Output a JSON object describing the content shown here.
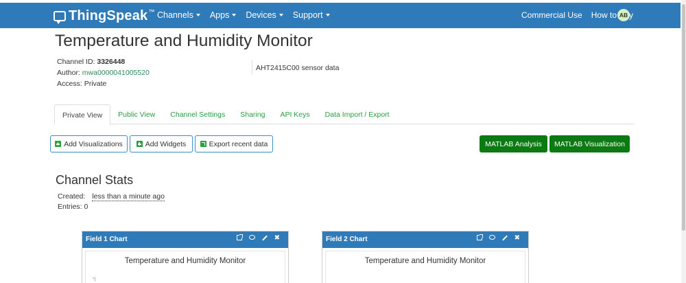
{
  "nav": {
    "brand": "ThingSpeak",
    "brand_mark": "™",
    "menu": [
      "Channels",
      "Apps",
      "Devices",
      "Support"
    ],
    "right_links": [
      "Commercial Use",
      "How to Buy"
    ],
    "avatar_initials": "AB"
  },
  "channel": {
    "title": "Temperature and Humidity Monitor",
    "id_label": "Channel ID:",
    "id_value": "3326448",
    "author_label": "Author:",
    "author_value": "mwa0000041005520",
    "access_label": "Access:",
    "access_value": "Private",
    "description": "AHT2415C00 sensor data"
  },
  "tabs": [
    "Private View",
    "Public View",
    "Channel Settings",
    "Sharing",
    "API Keys",
    "Data Import / Export"
  ],
  "active_tab": "Private View",
  "actions": {
    "add_visualizations": "Add Visualizations",
    "add_widgets": "Add Widgets",
    "export_recent": "Export recent data",
    "matlab_analysis": "MATLAB Analysis",
    "matlab_visualization": "MATLAB Visualization"
  },
  "stats": {
    "title": "Channel Stats",
    "created_label": "Created:",
    "created_value": "less than a minute ago",
    "entries_label": "Entries:",
    "entries_value": "0"
  },
  "cards": [
    {
      "header": "Field 1 Chart",
      "chart_title": "Temperature and Humidity Monitor",
      "axis_hint": "°("
    },
    {
      "header": "Field 2 Chart",
      "chart_title": "Temperature and Humidity Monitor"
    }
  ],
  "colors": {
    "navbar": "#2f7ab9",
    "link_green": "#2a9d3e",
    "matlab_green": "#0b7a12",
    "button_border": "#3a8fc9"
  }
}
